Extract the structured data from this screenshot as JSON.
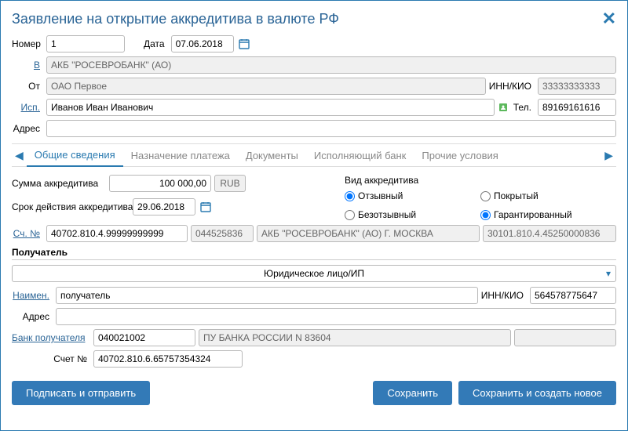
{
  "header": {
    "title": "Заявление на открытие аккредитива в валюте РФ"
  },
  "top": {
    "number_label": "Номер",
    "number": "1",
    "date_label": "Дата",
    "date": "07.06.2018",
    "v_label": "В",
    "v_value": "АКБ \"РОСЕВРОБАНК\" (АО)",
    "from_label": "От",
    "from_value": "ОАО Первое",
    "inn_label": "ИНН/КИО",
    "inn_value": "33333333333",
    "isp_label": "Исп.",
    "isp_value": "Иванов Иван Иванович",
    "tel_label": "Тел.",
    "tel_value": "89169161616",
    "addr_label": "Адрес",
    "addr_value": ""
  },
  "tabs": {
    "items": [
      "Общие сведения",
      "Назначение платежа",
      "Документы",
      "Исполняющий банк",
      "Прочие условия"
    ]
  },
  "general": {
    "sum_label": "Сумма аккредитива",
    "sum_value": "100 000,00",
    "currency": "RUB",
    "term_label": "Срок действия аккредитива",
    "term_value": "29.06.2018",
    "kind_label": "Вид аккредитива",
    "radios": {
      "otzyv": "Отзывный",
      "bezotzyv": "Безотзывный",
      "pokryt": "Покрытый",
      "garant": "Гарантированный"
    },
    "sch_label": "Сч. №",
    "sch_value": "40702.810.4.99999999999",
    "bik": "044525836",
    "bank_name": "АКБ \"РОСЕВРОБАНК\" (АО) Г. МОСКВА",
    "corr": "30101.810.4.45250000836"
  },
  "recipient": {
    "header": "Получатель",
    "type": "Юридическое лицо/ИП",
    "name_label": "Наимен.",
    "name_value": "получатель",
    "inn_label": "ИНН/КИО",
    "inn_value": "564578775647",
    "addr_label": "Адрес",
    "addr_value": "",
    "bank_label": "Банк получателя",
    "bank_bik": "040021002",
    "bank_name": "ПУ БАНКА РОССИИ N 83604",
    "bank_extra": "",
    "account_label": "Счет №",
    "account_value": "40702.810.6.65757354324"
  },
  "footer": {
    "sign": "Подписать и отправить",
    "save": "Сохранить",
    "save_new": "Сохранить и создать новое"
  }
}
